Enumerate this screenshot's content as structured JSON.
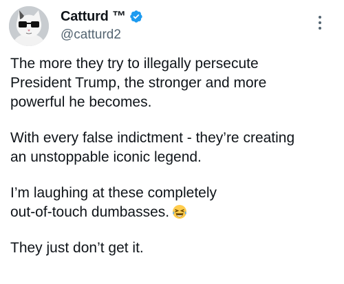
{
  "user": {
    "display_name": "Catturd ™",
    "handle": "@catturd2",
    "verified": true,
    "avatar_icon": "cat-with-glasses-avatar",
    "verified_icon": "verified-badge-icon",
    "colors": {
      "verified_blue": "#1d9bf0",
      "handle_gray": "#536471"
    }
  },
  "more_icon": "more-vertical-icon",
  "tweet": {
    "paragraphs": [
      "The more they try to illegally persecute\nPresident Trump, the stronger and more\npowerful he becomes.",
      "With every false indictment - they’re creating\nan unstoppable iconic legend.",
      "I’m laughing at these completely\nout-of-touch dumbasses.",
      "They just don’t get it."
    ],
    "emoji_icon": "laughing-tears-emoji-icon"
  }
}
